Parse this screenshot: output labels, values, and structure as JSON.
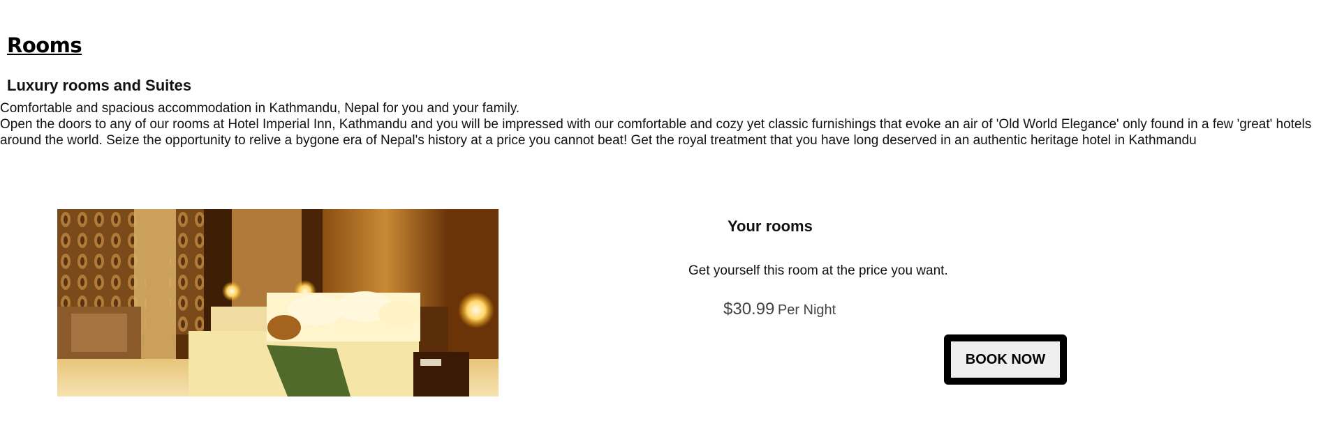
{
  "page": {
    "title": "Rooms",
    "section_title": "Luxury rooms and Suites",
    "intro_line1": "Comfortable and spacious accommodation in Kathmandu, Nepal for you and your family.",
    "intro_line2": "Open the doors to any of our rooms at Hotel Imperial Inn, Kathmandu and you will be impressed with our comfortable and cozy yet classic furnishings that evoke an air of 'Old World Elegance' only found in a few 'great' hotels around the world. Seize the opportunity to relive a bygone era of Nepal's history at a price you cannot beat! Get the royal treatment that you have long deserved in an authentic heritage hotel in Kathmandu"
  },
  "room_card": {
    "image_subject": "hotel room with bed, lamps and wooden panels",
    "heading": "Your rooms",
    "description": "Get yourself this room at the price you want.",
    "price": "$30.99",
    "price_unit": "Per Night",
    "book_label": "BOOK NOW"
  },
  "colors": {
    "button_border": "#000000",
    "button_fill": "#efefef",
    "price_text": "#444444"
  }
}
